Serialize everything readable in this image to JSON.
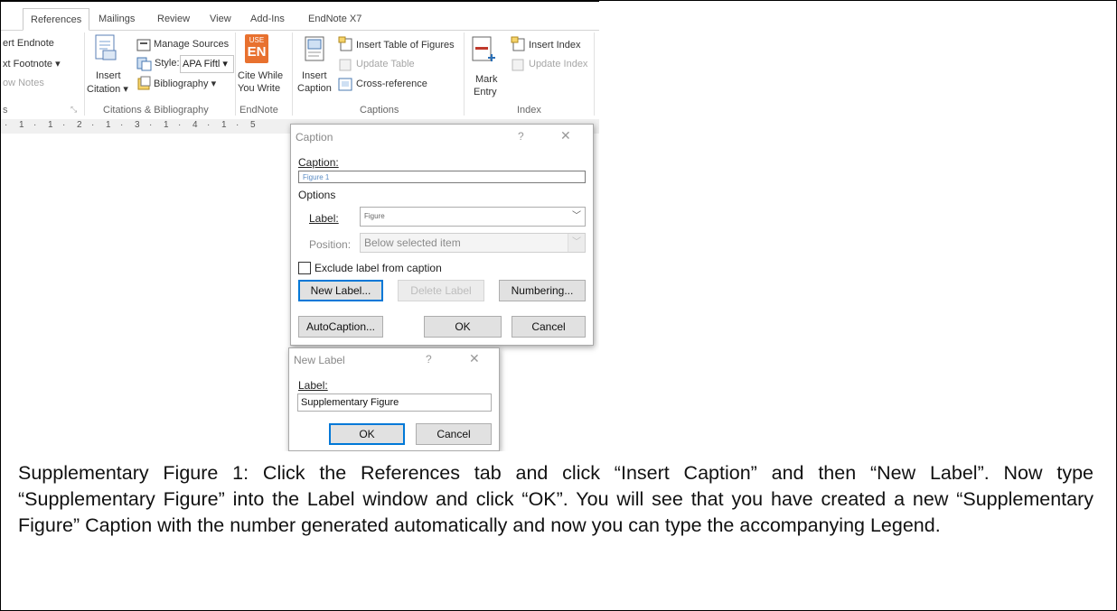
{
  "tabs": [
    "References",
    "Mailings",
    "Review",
    "View",
    "Add-Ins",
    "EndNote X7"
  ],
  "ribbon": {
    "footnotes": {
      "items": [
        "ert Endnote",
        "xt Footnote ▾",
        "ow Notes"
      ],
      "group_label": "s"
    },
    "citations": {
      "insert_citation": [
        "Insert",
        "Citation ▾"
      ],
      "manage_sources": "Manage Sources",
      "style_label": "Style:",
      "style_value": "APA Fiftl ▾",
      "bibliography": "Bibliography ▾",
      "group_label": "Citations & Bibliography"
    },
    "endnote": {
      "badge_top": "USE",
      "badge_bottom": "EN",
      "cite_while": [
        "Cite While",
        "You Write"
      ],
      "group_label": "EndNote"
    },
    "captions": {
      "insert_caption": [
        "Insert",
        "Caption"
      ],
      "insert_table_of_figures": "Insert Table of Figures",
      "update_table": "Update Table",
      "cross_reference": "Cross-reference",
      "group_label": "Captions"
    },
    "index": {
      "mark_entry": [
        "Mark",
        "Entry"
      ],
      "insert_index": "Insert Index",
      "update_index": "Update Index",
      "group_label": "Index"
    }
  },
  "ruler": {
    "marks": [
      "1",
      "·",
      "1",
      "·",
      "2",
      "·",
      "1",
      "·",
      "3",
      "·",
      "1",
      "·",
      "4",
      "·",
      "1",
      "·",
      "5"
    ]
  },
  "caption_dialog": {
    "title": "Caption",
    "help": "?",
    "close": "✕",
    "caption_label": "Caption:",
    "caption_value": "Figure 1",
    "options_label": "Options",
    "label_label": "Label:",
    "label_value": "Figure",
    "position_label": "Position:",
    "position_value": "Below selected item",
    "exclude_label": "Exclude label from caption",
    "buttons": {
      "new_label": "New Label...",
      "delete_label": "Delete Label",
      "numbering": "Numbering...",
      "autocaption": "AutoCaption...",
      "ok": "OK",
      "cancel": "Cancel"
    }
  },
  "new_label_dialog": {
    "title": "New Label",
    "help": "?",
    "close": "✕",
    "label_label": "Label:",
    "label_value": "Supplementary Figure",
    "ok": "OK",
    "cancel": "Cancel"
  },
  "caption_text": "Supplementary Figure 1: Click the References tab and click “Insert Caption” and then “New Label”. Now type “Supplementary Figure” into the Label window and click “OK”. You will see that you have created a new “Supplementary Figure” Caption with the number generated automatically and now you can type the accompanying Legend."
}
